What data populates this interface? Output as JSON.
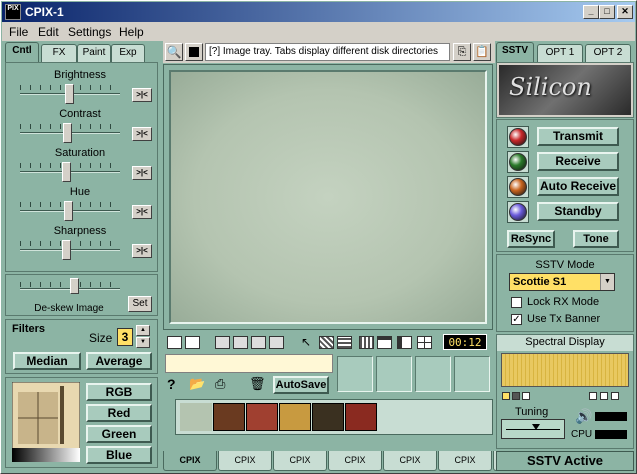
{
  "window": {
    "title": "CPIX-1",
    "icon_text": "PIX"
  },
  "menu": [
    "File",
    "Edit",
    "Settings",
    "Help"
  ],
  "left_tabs": [
    "Cntl",
    "FX",
    "Paint",
    "Exp"
  ],
  "sliders": [
    {
      "label": "Brightness",
      "value": 0.49
    },
    {
      "label": "Contrast",
      "value": 0.47
    },
    {
      "label": "Saturation",
      "value": 0.46
    },
    {
      "label": "Hue",
      "value": 0.48
    },
    {
      "label": "Sharpness",
      "value": 0.46
    }
  ],
  "reset_label": ">|<",
  "deskew": {
    "label": "De-skew Image",
    "set_label": "Set"
  },
  "filters": {
    "title": "Filters",
    "size_label": "Size",
    "size_value": "3",
    "median": "Median",
    "average": "Average"
  },
  "color_buttons": [
    "RGB",
    "Red",
    "Green",
    "Blue"
  ],
  "toolbar": {
    "tip": "[?] Image tray. Tabs display different disk directories"
  },
  "timer": "00:12",
  "autosave": "AutoSave",
  "tray_tabs": [
    "CPIX",
    "CPIX",
    "CPIX",
    "CPIX",
    "CPIX",
    "CPIX",
    "CPIX"
  ],
  "right_tabs": [
    "SSTV",
    "OPT 1",
    "OPT 2"
  ],
  "logo_text": "Silicon",
  "controls": [
    {
      "label": "Transmit",
      "led": "#c8282a"
    },
    {
      "label": "Receive",
      "led": "#2a7a2a"
    },
    {
      "label": "Auto Receive",
      "led": "#c8641e"
    },
    {
      "label": "Standby",
      "led": "#6a5adc"
    }
  ],
  "resync": "ReSync",
  "tone": "Tone",
  "sstv_mode": {
    "title": "SSTV Mode",
    "value": "Scottie S1",
    "lock_rx": "Lock RX Mode",
    "lock_checked": false,
    "use_banner": "Use Tx Banner",
    "banner_checked": true
  },
  "spectral": {
    "title": "Spectral Display"
  },
  "tuning": {
    "label": "Tuning",
    "cpu": "CPU"
  },
  "status": "SSTV Active",
  "colors": {
    "panel": "#8cb4a4",
    "accent": "#0a246a",
    "timer": "#ffe066"
  }
}
